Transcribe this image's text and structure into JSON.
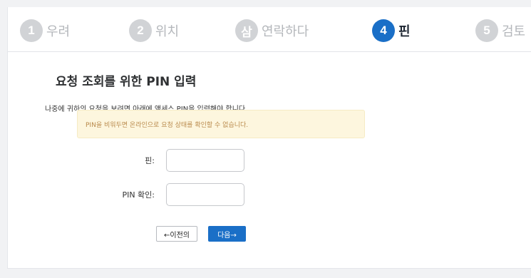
{
  "steps": [
    {
      "number": "1",
      "label": "우려",
      "active": false
    },
    {
      "number": "2",
      "label": "위치",
      "active": false
    },
    {
      "number": "삼",
      "label": "연락하다",
      "active": false
    },
    {
      "number": "4",
      "label": "핀",
      "active": true
    },
    {
      "number": "5",
      "label": "검토",
      "active": false
    }
  ],
  "form": {
    "title": "요청 조회를 위한 PIN 입력",
    "description": "나중에 귀하의 요청을 보려면 아래에 액세스 PIN을 입력해야 합니다.",
    "warning": "PIN을 비워두면 온라인으로 요청 상태를 확인할 수 없습니다.",
    "pin_label": "핀:",
    "pin_value": "",
    "pin_confirm_label": "PIN 확인:",
    "pin_confirm_value": ""
  },
  "buttons": {
    "prev": "←이전의",
    "next": "다음→"
  },
  "colors": {
    "accent": "#1a6fc7",
    "step_inactive": "#d1d3d6",
    "warning_bg": "#fdf6de",
    "warning_text": "#b98a4c"
  }
}
